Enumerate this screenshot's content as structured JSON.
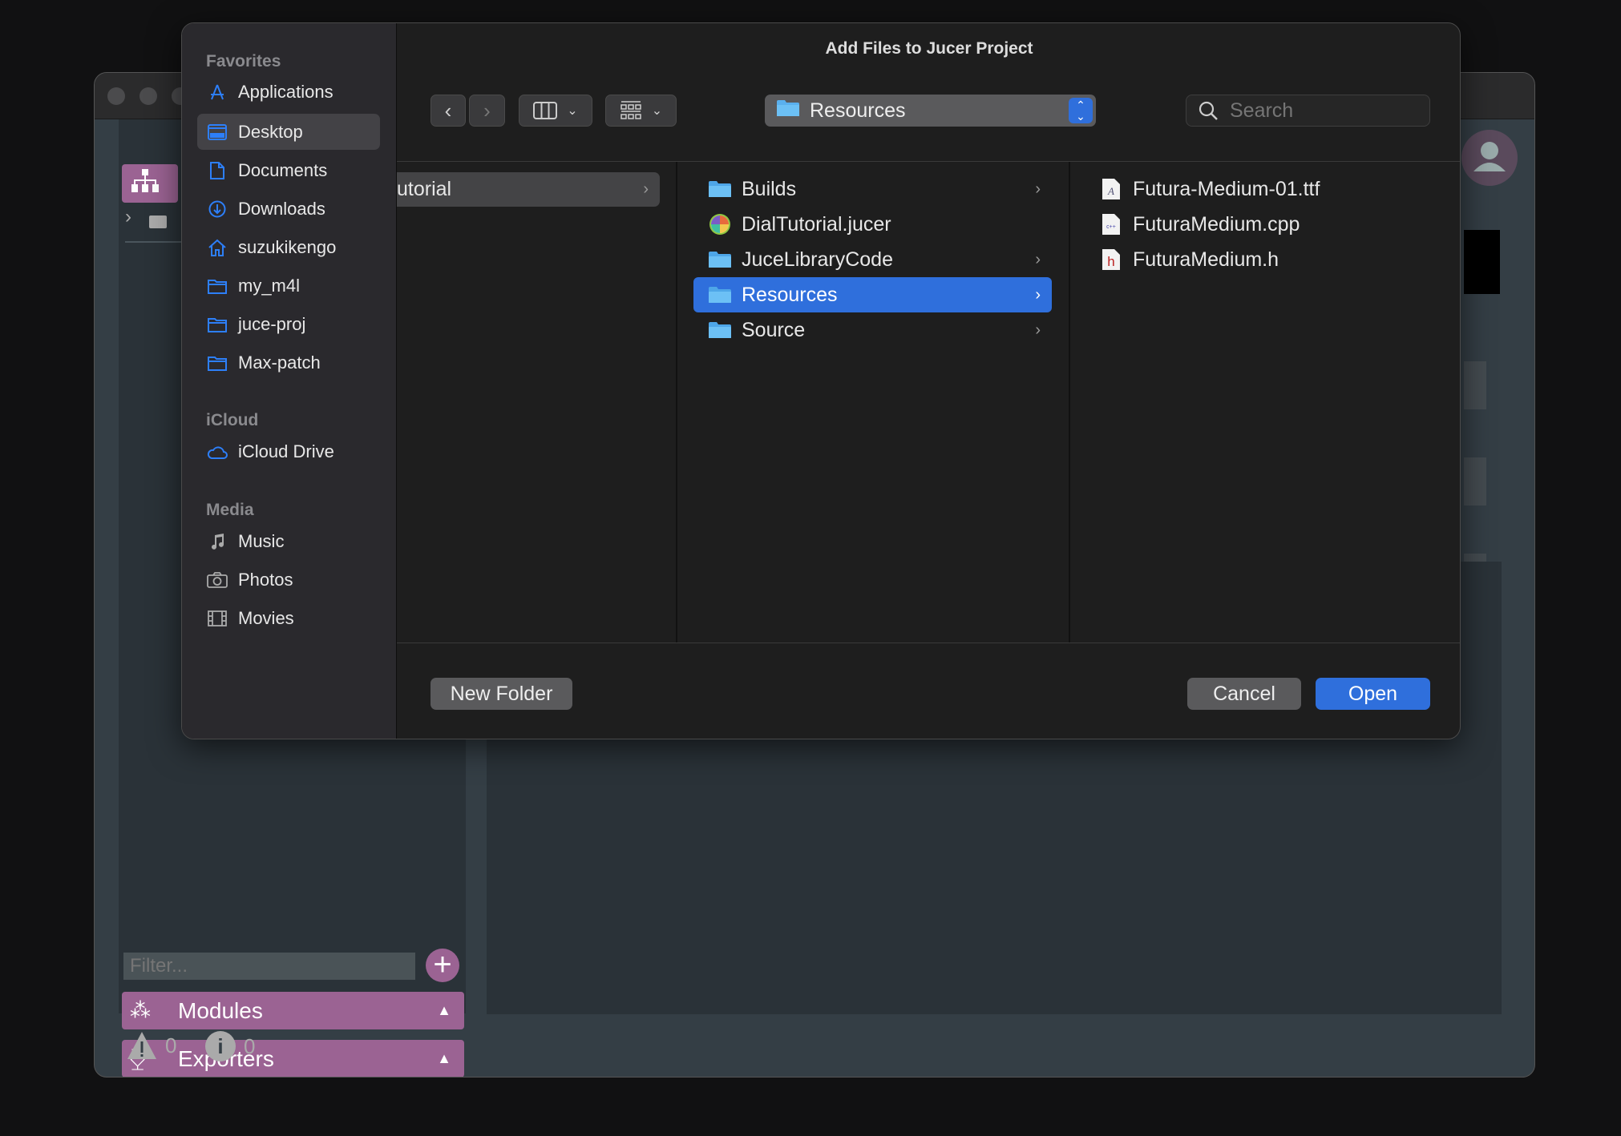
{
  "jucer": {
    "filter_placeholder": "Filter...",
    "modules_label": "Modules",
    "exporters_label": "Exporters",
    "warnings_count": "0",
    "info_count": "0",
    "accent": "#9b6393"
  },
  "dialog": {
    "title": "Add Files to Jucer Project",
    "search_placeholder": "Search",
    "path_popup": "Resources",
    "sidebar": {
      "favorites_header": "Favorites",
      "favorites": [
        {
          "label": "Applications",
          "icon": "applications-icon"
        },
        {
          "label": "Desktop",
          "icon": "desktop-icon",
          "selected": true
        },
        {
          "label": "Documents",
          "icon": "document-icon"
        },
        {
          "label": "Downloads",
          "icon": "download-icon"
        },
        {
          "label": "suzukikengo",
          "icon": "home-icon"
        },
        {
          "label": "my_m4l",
          "icon": "folder-icon"
        },
        {
          "label": "juce-proj",
          "icon": "folder-icon"
        },
        {
          "label": "Max-patch",
          "icon": "folder-icon"
        }
      ],
      "icloud_header": "iCloud",
      "icloud": [
        {
          "label": "iCloud Drive",
          "icon": "cloud-icon"
        }
      ],
      "media_header": "Media",
      "media": [
        {
          "label": "Music",
          "icon": "music-icon"
        },
        {
          "label": "Photos",
          "icon": "camera-icon"
        },
        {
          "label": "Movies",
          "icon": "film-icon"
        }
      ]
    },
    "column1": [
      {
        "label": "utorial"
      }
    ],
    "column2": [
      {
        "label": "Builds",
        "type": "folder"
      },
      {
        "label": "DialTutorial.jucer",
        "type": "jucer"
      },
      {
        "label": "JuceLibraryCode",
        "type": "folder"
      },
      {
        "label": "Resources",
        "type": "folder",
        "selected": true
      },
      {
        "label": "Source",
        "type": "folder"
      }
    ],
    "column3": [
      {
        "label": "Futura-Medium-01.ttf",
        "type": "font"
      },
      {
        "label": "FuturaMedium.cpp",
        "type": "cpp"
      },
      {
        "label": "FuturaMedium.h",
        "type": "h"
      }
    ],
    "new_folder": "New Folder",
    "cancel": "Cancel",
    "open": "Open",
    "accent": "#2f6fdc"
  }
}
